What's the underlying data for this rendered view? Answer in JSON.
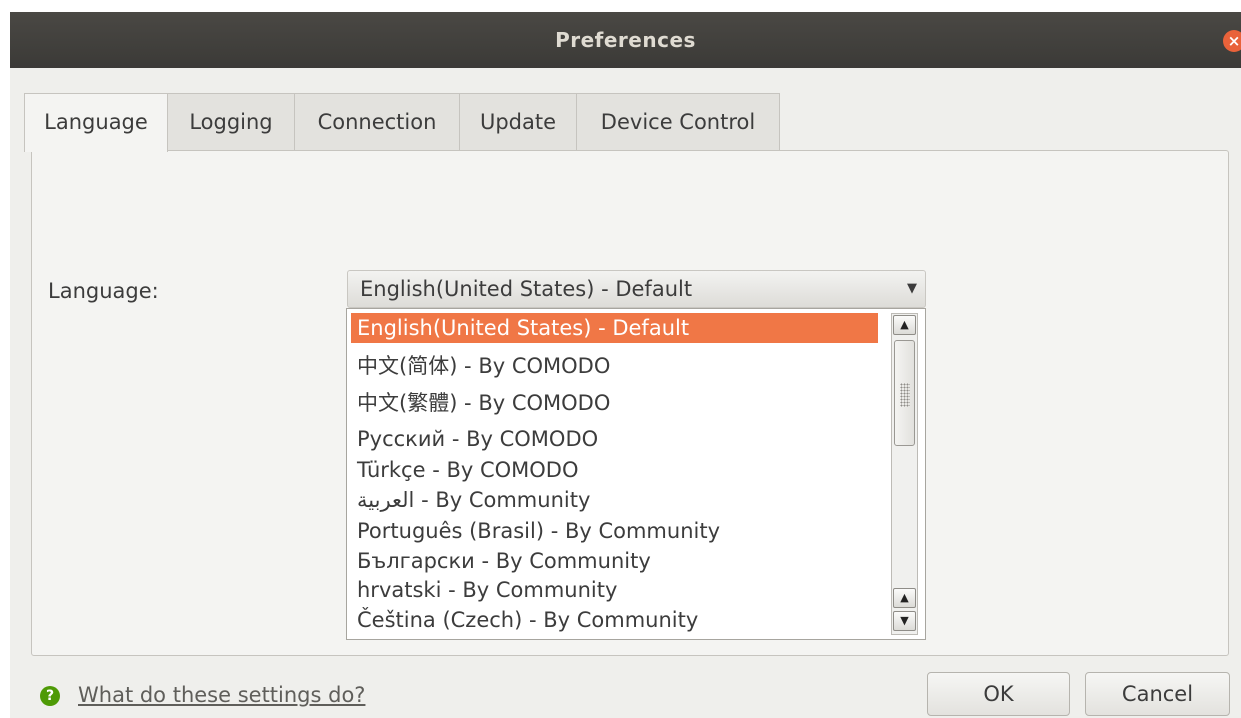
{
  "window": {
    "title": "Preferences"
  },
  "tabs": [
    {
      "label": "Language",
      "active": true
    },
    {
      "label": "Logging",
      "active": false
    },
    {
      "label": "Connection",
      "active": false
    },
    {
      "label": "Update",
      "active": false
    },
    {
      "label": "Device Control",
      "active": false
    }
  ],
  "language_field": {
    "label": "Language:",
    "selected": "English(United States) - Default",
    "options": [
      "English(United States) - Default",
      "中文(简体) - By COMODO",
      "中文(繁體) - By COMODO",
      "Русский - By COMODO",
      "Türkçe - By COMODO",
      "العربية - By Community",
      "Português (Brasil) - By Community",
      "Български - By Community",
      "hrvatski - By Community",
      "Čeština (Czech) - By Community"
    ]
  },
  "footer": {
    "help_link": "What do these settings do?",
    "ok_label": "OK",
    "cancel_label": "Cancel"
  },
  "colors": {
    "accent_selection": "#f07746",
    "titlebar": "#3b3a37",
    "help_icon": "#4e9a06"
  }
}
